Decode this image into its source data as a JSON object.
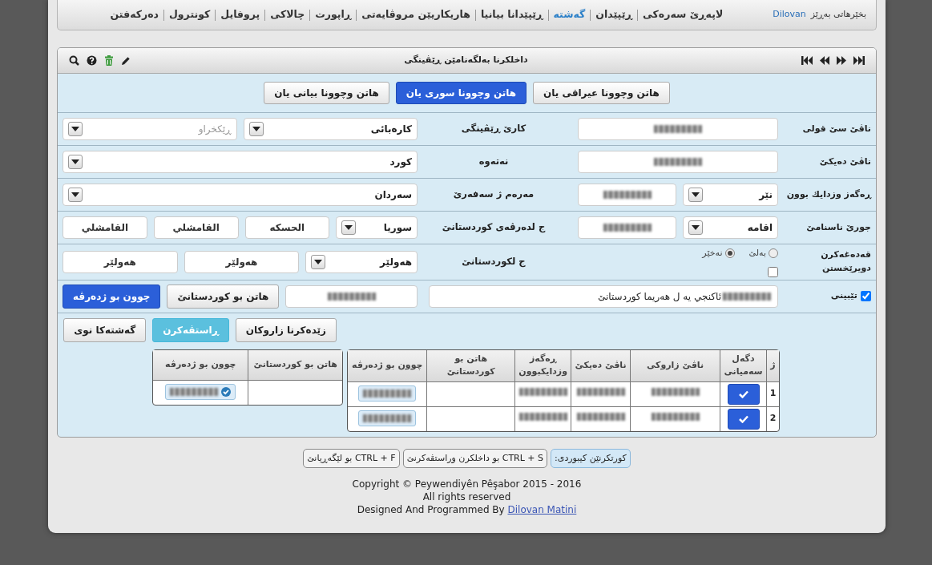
{
  "nav": {
    "welcome": "بخێرهاتی بەڕێز",
    "user": "Dilovan",
    "items": [
      {
        "label": "لاپەڕێ سەرەکی",
        "selected": false
      },
      {
        "label": "ڕێپێدان",
        "selected": false
      },
      {
        "label": "گەشتە",
        "selected": true
      },
      {
        "label": "ڕێپێدانا بیانیا",
        "selected": false
      },
      {
        "label": "هاریکاریێن مروڤایەتی",
        "selected": false
      },
      {
        "label": "ڕاپورت",
        "selected": false
      },
      {
        "label": "چالاکی",
        "selected": false
      },
      {
        "label": "پروفایل",
        "selected": false
      },
      {
        "label": "کونترول",
        "selected": false
      },
      {
        "label": "دەرکەفتن",
        "selected": false
      }
    ]
  },
  "panel": {
    "title": "داخلکرنا بەلگەنامێن ڕێڤینگی"
  },
  "tabs": [
    {
      "label": "هاتن وچوونا عیراقی یان",
      "selected": false
    },
    {
      "label": "هاتن وچوونا سوری یان",
      "selected": true
    },
    {
      "label": "هاتن وچوونا بیانی یان",
      "selected": false
    }
  ],
  "form": {
    "rows": [
      {
        "label": "ناڤێ سێ قولی",
        "main": [
          {
            "kind": "input",
            "redacted": true
          }
        ],
        "label2": "کارێ ڕێڤینگی",
        "side": [
          {
            "kind": "select",
            "value": "کارەبائی"
          },
          {
            "kind": "select",
            "placeholder": "ڕێکخراو"
          }
        ]
      },
      {
        "label": "ناڤێ دەیکێ",
        "main": [
          {
            "kind": "input",
            "redacted": true
          }
        ],
        "label2": "نەتەوە",
        "side": [
          {
            "kind": "select",
            "value": "کورد"
          }
        ]
      },
      {
        "label": "ڕەگەز وزدایك بوون",
        "main": [
          {
            "kind": "select",
            "value": "نێر"
          },
          {
            "kind": "input",
            "redacted": true
          }
        ],
        "label2": "مەرەم ژ سەفەرێ",
        "side": [
          {
            "kind": "select",
            "value": "سەردان"
          }
        ]
      },
      {
        "label": "جورێ ناسنامێ",
        "main": [
          {
            "kind": "select",
            "value": "اقامە"
          },
          {
            "kind": "input",
            "redacted": true
          }
        ],
        "label2": "ج لدەرڤەی کوردستانێ",
        "side": [
          {
            "kind": "select",
            "value": "سوریا"
          },
          {
            "kind": "input",
            "value": "الحسكە"
          },
          {
            "kind": "input",
            "value": "القامشلي"
          },
          {
            "kind": "input",
            "value": "القامشلي"
          }
        ]
      },
      {
        "label": "قەدەغەکرن دویرێخستن",
        "main": [
          {
            "kind": "radio",
            "label": "بەلێ",
            "selected": false
          },
          {
            "kind": "radio",
            "label": "نەخێر",
            "selected": true
          },
          {
            "kind": "checkbox",
            "checked": false
          }
        ],
        "label2": "ج لکوردستانێ",
        "side": [
          {
            "kind": "select",
            "value": "هەولێر"
          },
          {
            "kind": "input",
            "value": "هەولێر"
          },
          {
            "kind": "input",
            "value": "هەولێر"
          }
        ]
      },
      {
        "label": "تێبینی",
        "label_checkbox": {
          "checked": true
        },
        "main": [
          {
            "kind": "input",
            "redacted": true,
            "value": "ئاكنجي يه ل هه‌ريما كوردستانێ"
          }
        ],
        "side": [
          {
            "kind": "input",
            "redacted": true
          },
          {
            "kind": "button",
            "label": "هاتن بو کوردستانێ"
          },
          {
            "kind": "primary-button",
            "label": "چوون بو ژدەرڤە"
          }
        ]
      }
    ],
    "actions": [
      {
        "kind": "button",
        "label": "زێدەکرنا زاروکان"
      },
      {
        "kind": "info-button",
        "label": "ڕاستڤەکرن"
      },
      {
        "kind": "button",
        "label": "گەشتەکا نوی"
      }
    ]
  },
  "children_table": {
    "columns": [
      "ژ",
      "دگەل سەمیانی",
      "ناڤێ زاروکی",
      "ناڤێ دەیکێ",
      "ڕەگەز وزدایکبوون",
      "هاتن بو کوردستانێ",
      "چوون بو ژدەرڤە"
    ],
    "rows": [
      {
        "cells": [
          {
            "kind": "text",
            "text": "1"
          },
          {
            "kind": "check-button"
          },
          {
            "kind": "redacted"
          },
          {
            "kind": "redacted"
          },
          {
            "kind": "redacted"
          },
          {
            "kind": "empty"
          },
          {
            "kind": "redacted-badge"
          }
        ]
      },
      {
        "cells": [
          {
            "kind": "text",
            "text": "2"
          },
          {
            "kind": "check-button"
          },
          {
            "kind": "redacted"
          },
          {
            "kind": "redacted"
          },
          {
            "kind": "redacted"
          },
          {
            "kind": "empty"
          },
          {
            "kind": "redacted-badge"
          }
        ]
      }
    ]
  },
  "travel_table": {
    "columns": [
      "هاتن بو کوردستانێ",
      "چوون بو ژدەرڤە"
    ],
    "rows": [
      {
        "cells": [
          {
            "kind": "empty"
          },
          {
            "kind": "badge-check"
          }
        ]
      }
    ]
  },
  "shortcuts": [
    {
      "text": "کورتکرنێن کیبوردی:",
      "kind": "info"
    },
    {
      "text": "CTRL + S بو داخلکرن وراستڤەکرنێ",
      "kind": "default"
    },
    {
      "text": "CTRL + F بو لێگەڕیانێ",
      "kind": "default"
    }
  ],
  "footer": {
    "copyright": "Copyright © Peywendiyên Pêşabor 2015 - 2016",
    "rights": "All rights reserved",
    "credit": "Designed And Programmed By",
    "author": "Dilovan Matini"
  }
}
